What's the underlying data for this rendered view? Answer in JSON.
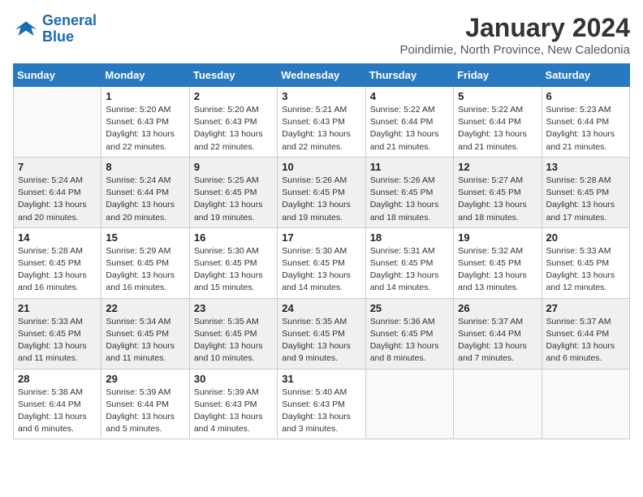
{
  "logo": {
    "line1": "General",
    "line2": "Blue"
  },
  "title": "January 2024",
  "subtitle": "Poindimie, North Province, New Caledonia",
  "weekdays": [
    "Sunday",
    "Monday",
    "Tuesday",
    "Wednesday",
    "Thursday",
    "Friday",
    "Saturday"
  ],
  "weeks": [
    [
      {
        "day": "",
        "info": ""
      },
      {
        "day": "1",
        "info": "Sunrise: 5:20 AM\nSunset: 6:43 PM\nDaylight: 13 hours\nand 22 minutes."
      },
      {
        "day": "2",
        "info": "Sunrise: 5:20 AM\nSunset: 6:43 PM\nDaylight: 13 hours\nand 22 minutes."
      },
      {
        "day": "3",
        "info": "Sunrise: 5:21 AM\nSunset: 6:43 PM\nDaylight: 13 hours\nand 22 minutes."
      },
      {
        "day": "4",
        "info": "Sunrise: 5:22 AM\nSunset: 6:44 PM\nDaylight: 13 hours\nand 21 minutes."
      },
      {
        "day": "5",
        "info": "Sunrise: 5:22 AM\nSunset: 6:44 PM\nDaylight: 13 hours\nand 21 minutes."
      },
      {
        "day": "6",
        "info": "Sunrise: 5:23 AM\nSunset: 6:44 PM\nDaylight: 13 hours\nand 21 minutes."
      }
    ],
    [
      {
        "day": "7",
        "info": "Sunrise: 5:24 AM\nSunset: 6:44 PM\nDaylight: 13 hours\nand 20 minutes."
      },
      {
        "day": "8",
        "info": "Sunrise: 5:24 AM\nSunset: 6:44 PM\nDaylight: 13 hours\nand 20 minutes."
      },
      {
        "day": "9",
        "info": "Sunrise: 5:25 AM\nSunset: 6:45 PM\nDaylight: 13 hours\nand 19 minutes."
      },
      {
        "day": "10",
        "info": "Sunrise: 5:26 AM\nSunset: 6:45 PM\nDaylight: 13 hours\nand 19 minutes."
      },
      {
        "day": "11",
        "info": "Sunrise: 5:26 AM\nSunset: 6:45 PM\nDaylight: 13 hours\nand 18 minutes."
      },
      {
        "day": "12",
        "info": "Sunrise: 5:27 AM\nSunset: 6:45 PM\nDaylight: 13 hours\nand 18 minutes."
      },
      {
        "day": "13",
        "info": "Sunrise: 5:28 AM\nSunset: 6:45 PM\nDaylight: 13 hours\nand 17 minutes."
      }
    ],
    [
      {
        "day": "14",
        "info": "Sunrise: 5:28 AM\nSunset: 6:45 PM\nDaylight: 13 hours\nand 16 minutes."
      },
      {
        "day": "15",
        "info": "Sunrise: 5:29 AM\nSunset: 6:45 PM\nDaylight: 13 hours\nand 16 minutes."
      },
      {
        "day": "16",
        "info": "Sunrise: 5:30 AM\nSunset: 6:45 PM\nDaylight: 13 hours\nand 15 minutes."
      },
      {
        "day": "17",
        "info": "Sunrise: 5:30 AM\nSunset: 6:45 PM\nDaylight: 13 hours\nand 14 minutes."
      },
      {
        "day": "18",
        "info": "Sunrise: 5:31 AM\nSunset: 6:45 PM\nDaylight: 13 hours\nand 14 minutes."
      },
      {
        "day": "19",
        "info": "Sunrise: 5:32 AM\nSunset: 6:45 PM\nDaylight: 13 hours\nand 13 minutes."
      },
      {
        "day": "20",
        "info": "Sunrise: 5:33 AM\nSunset: 6:45 PM\nDaylight: 13 hours\nand 12 minutes."
      }
    ],
    [
      {
        "day": "21",
        "info": "Sunrise: 5:33 AM\nSunset: 6:45 PM\nDaylight: 13 hours\nand 11 minutes."
      },
      {
        "day": "22",
        "info": "Sunrise: 5:34 AM\nSunset: 6:45 PM\nDaylight: 13 hours\nand 11 minutes."
      },
      {
        "day": "23",
        "info": "Sunrise: 5:35 AM\nSunset: 6:45 PM\nDaylight: 13 hours\nand 10 minutes."
      },
      {
        "day": "24",
        "info": "Sunrise: 5:35 AM\nSunset: 6:45 PM\nDaylight: 13 hours\nand 9 minutes."
      },
      {
        "day": "25",
        "info": "Sunrise: 5:36 AM\nSunset: 6:45 PM\nDaylight: 13 hours\nand 8 minutes."
      },
      {
        "day": "26",
        "info": "Sunrise: 5:37 AM\nSunset: 6:44 PM\nDaylight: 13 hours\nand 7 minutes."
      },
      {
        "day": "27",
        "info": "Sunrise: 5:37 AM\nSunset: 6:44 PM\nDaylight: 13 hours\nand 6 minutes."
      }
    ],
    [
      {
        "day": "28",
        "info": "Sunrise: 5:38 AM\nSunset: 6:44 PM\nDaylight: 13 hours\nand 6 minutes."
      },
      {
        "day": "29",
        "info": "Sunrise: 5:39 AM\nSunset: 6:44 PM\nDaylight: 13 hours\nand 5 minutes."
      },
      {
        "day": "30",
        "info": "Sunrise: 5:39 AM\nSunset: 6:43 PM\nDaylight: 13 hours\nand 4 minutes."
      },
      {
        "day": "31",
        "info": "Sunrise: 5:40 AM\nSunset: 6:43 PM\nDaylight: 13 hours\nand 3 minutes."
      },
      {
        "day": "",
        "info": ""
      },
      {
        "day": "",
        "info": ""
      },
      {
        "day": "",
        "info": ""
      }
    ]
  ]
}
